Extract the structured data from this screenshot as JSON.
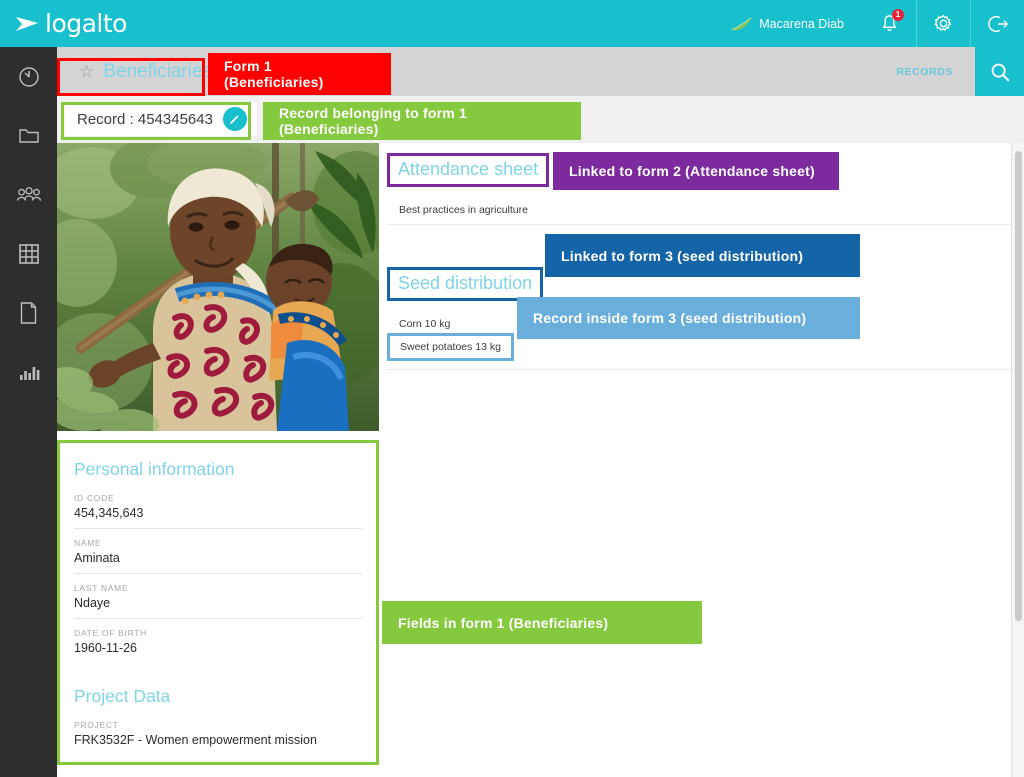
{
  "app": {
    "logo_text": "logalto",
    "logo_icon": "paper-plane-icon"
  },
  "topbar": {
    "user_name": "Macarena Diab",
    "leaf_icon": "leaf-icon",
    "notification_icon": "bell-icon",
    "notification_count": "1",
    "settings_icon": "gear-icon",
    "logout_icon": "logout-icon"
  },
  "sidebar": {
    "items": [
      {
        "name": "dashboard",
        "icon": "gauge-icon"
      },
      {
        "name": "projects",
        "icon": "folder-icon"
      },
      {
        "name": "beneficiaries",
        "icon": "people-icon"
      },
      {
        "name": "tables",
        "icon": "grid-icon"
      },
      {
        "name": "forms",
        "icon": "document-icon"
      },
      {
        "name": "reports",
        "icon": "bar-chart-icon"
      }
    ]
  },
  "tabbar": {
    "star_icon": "star-icon",
    "active_tab": "Beneficiaries",
    "records_tab": "RECORDS",
    "search_icon": "search-icon"
  },
  "record_bar": {
    "label": "Record : 454345643",
    "edit_icon": "pencil-icon"
  },
  "photo": {
    "alt": "woman farmer carrying hoe with baby on her back"
  },
  "form": {
    "sections": [
      {
        "title": "Personal information",
        "fields": [
          {
            "label": "ID CODE",
            "value": "454,345,643"
          },
          {
            "label": "NAME",
            "value": "Aminata"
          },
          {
            "label": "LAST NAME",
            "value": "Ndaye"
          },
          {
            "label": "DATE OF BIRTH",
            "value": "1960-11-26"
          }
        ]
      },
      {
        "title": "Project Data",
        "fields": [
          {
            "label": "PROJECT",
            "value": "FRK3532F - Women empowerment mission"
          }
        ]
      }
    ]
  },
  "linked_forms": [
    {
      "heading": "Attendance sheet",
      "rows": [
        {
          "text": "Best practices in agriculture"
        }
      ]
    },
    {
      "heading": "Seed distribution",
      "rows": [
        {
          "text": "Corn 10 kg"
        },
        {
          "text": "Sweet potatoes 13 kg"
        }
      ]
    }
  ],
  "annotations": [
    {
      "id": "form1",
      "text": "Form 1 (Beneficiaries)"
    },
    {
      "id": "record",
      "text": "Record belonging to form 1 (Beneficiaries)"
    },
    {
      "id": "linkform2",
      "text": "Linked to form 2 (Attendance sheet)"
    },
    {
      "id": "linkform3",
      "text": "Linked  to form 3 (seed distribution)"
    },
    {
      "id": "recform3",
      "text": "Record inside form 3 (seed distribution)"
    },
    {
      "id": "fieldsform1",
      "text": "Fields in form 1 (Beneficiaries)"
    }
  ],
  "colors": {
    "brand_teal": "#18BFCD",
    "annotation_red": "#FF0000",
    "annotation_green": "#85CA3E",
    "annotation_purple": "#7D2A9E",
    "annotation_blue": "#1664A8",
    "annotation_light_blue": "#6AAFDC",
    "heading_blue": "#7FD4E8",
    "rail_dark": "#2E2E2E"
  }
}
